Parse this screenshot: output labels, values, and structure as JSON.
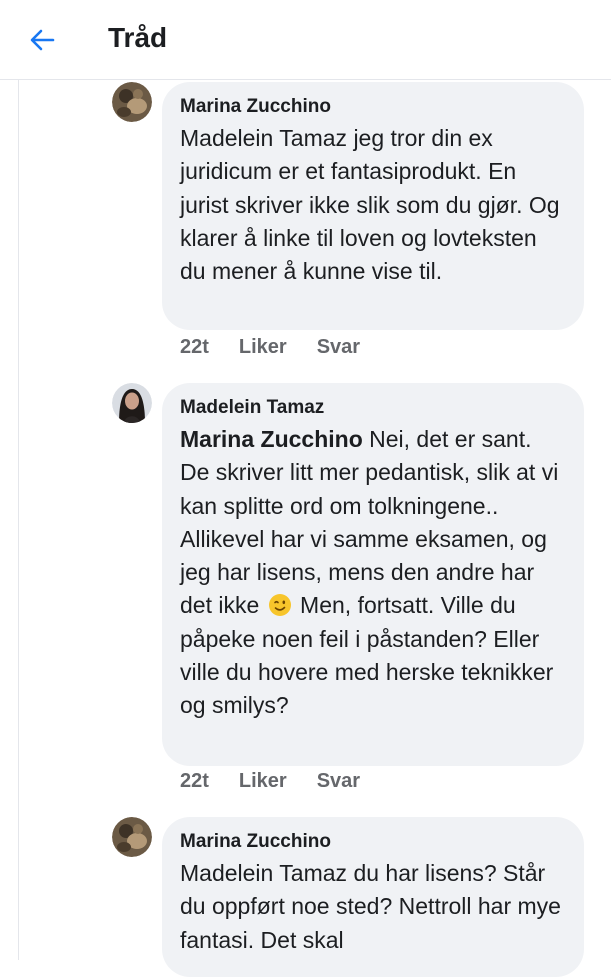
{
  "header": {
    "title": "Tråd"
  },
  "comments": [
    {
      "author": "Marina Zucchino",
      "text": "Madelein Tamaz jeg tror din ex juridicum er et fantasiprodukt. En jurist skriver ikke slik som du gjør. Og klarer å linke til loven og lovteksten du mener å kunne vise til.",
      "time": "22t",
      "like_label": "Liker",
      "reply_label": "Svar"
    },
    {
      "author": "Madelein Tamaz",
      "mention": "Marina Zucchino",
      "text_a": " Nei, det er sant. De skriver litt mer pedantisk, slik at vi kan splitte ord om tolkningene..",
      "text_b": "Allikevel har vi samme eksamen, og jeg har lisens, mens den andre har det ikke",
      "emoji": "winking-face-emoji",
      "text_c": " Men, fortsatt. Ville du påpeke noen feil i påstanden? Eller ville du hovere med herske teknikker og smilys?",
      "time": "22t",
      "like_label": "Liker",
      "reply_label": "Svar"
    },
    {
      "author": "Marina Zucchino",
      "text": "Madelein Tamaz du har lisens? Står du oppført noe sted? Nettroll har mye fantasi. Det skal"
    }
  ],
  "colors": {
    "accent": "#1877f2",
    "bubble": "#f0f2f5",
    "meta_text": "#65676b"
  },
  "icons": {
    "back": "arrow-left-icon"
  }
}
